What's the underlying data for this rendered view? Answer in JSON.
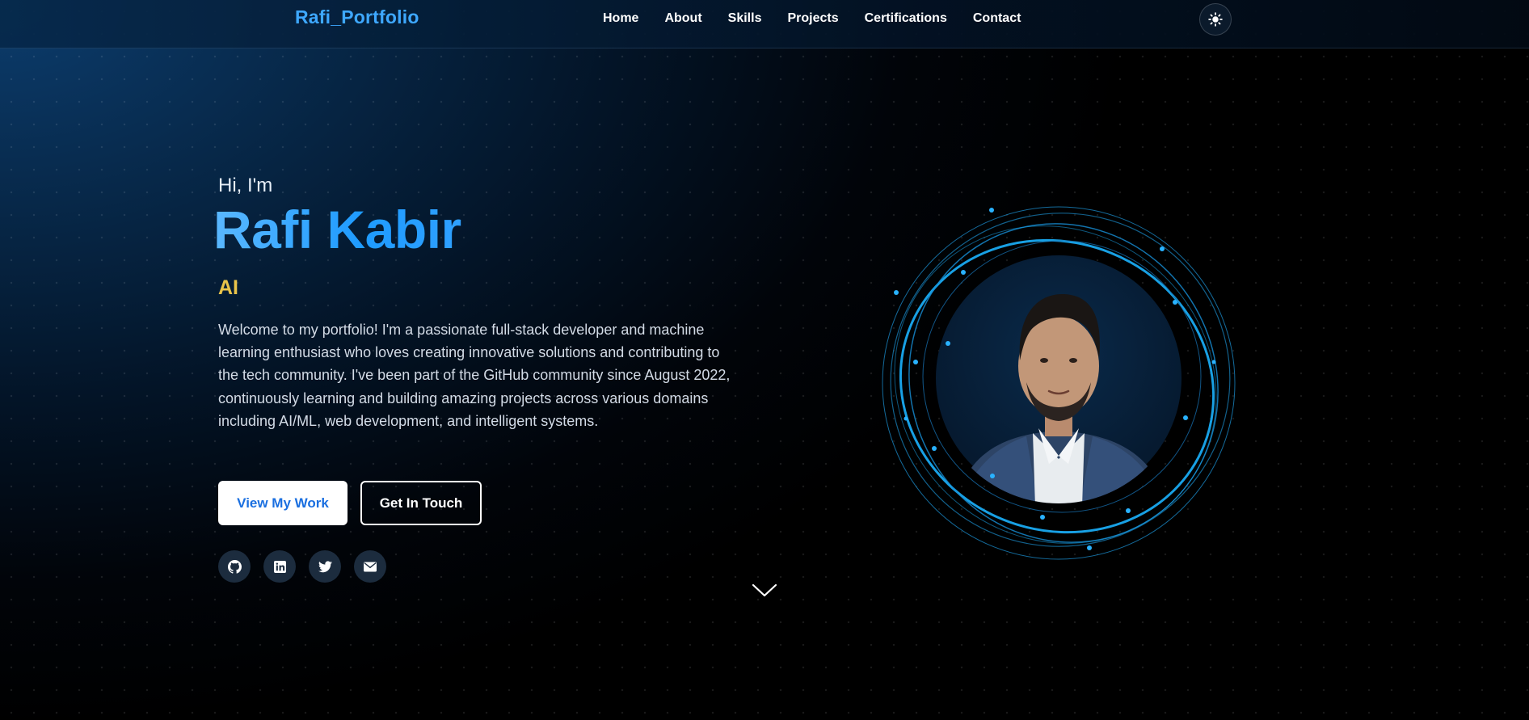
{
  "header": {
    "brand": "Rafi_Portfolio",
    "nav": [
      "Home",
      "About",
      "Skills",
      "Projects",
      "Certifications",
      "Contact"
    ],
    "theme_toggle_icon": "sun-icon"
  },
  "hero": {
    "greeting": "Hi, I'm",
    "name": "Rafi Kabir",
    "role": "AI",
    "bio": "Welcome to my portfolio! I'm a passionate full-stack developer and machine learning enthusiast who loves creating innovative solutions and contributing to the tech community. I've been part of the GitHub community since August 2022, continuously learning and building amazing projects across various domains including AI/ML, web development, and intelligent systems.",
    "primary_button": "View My Work",
    "secondary_button": "Get In Touch",
    "socials": [
      "github-icon",
      "linkedin-icon",
      "twitter-icon",
      "email-icon"
    ],
    "scroll_icon": "chevron-down-icon"
  },
  "colors": {
    "accent": "#3ea8ff",
    "role_color": "#e9c44a",
    "primary_button_text": "#1a6fe0"
  }
}
